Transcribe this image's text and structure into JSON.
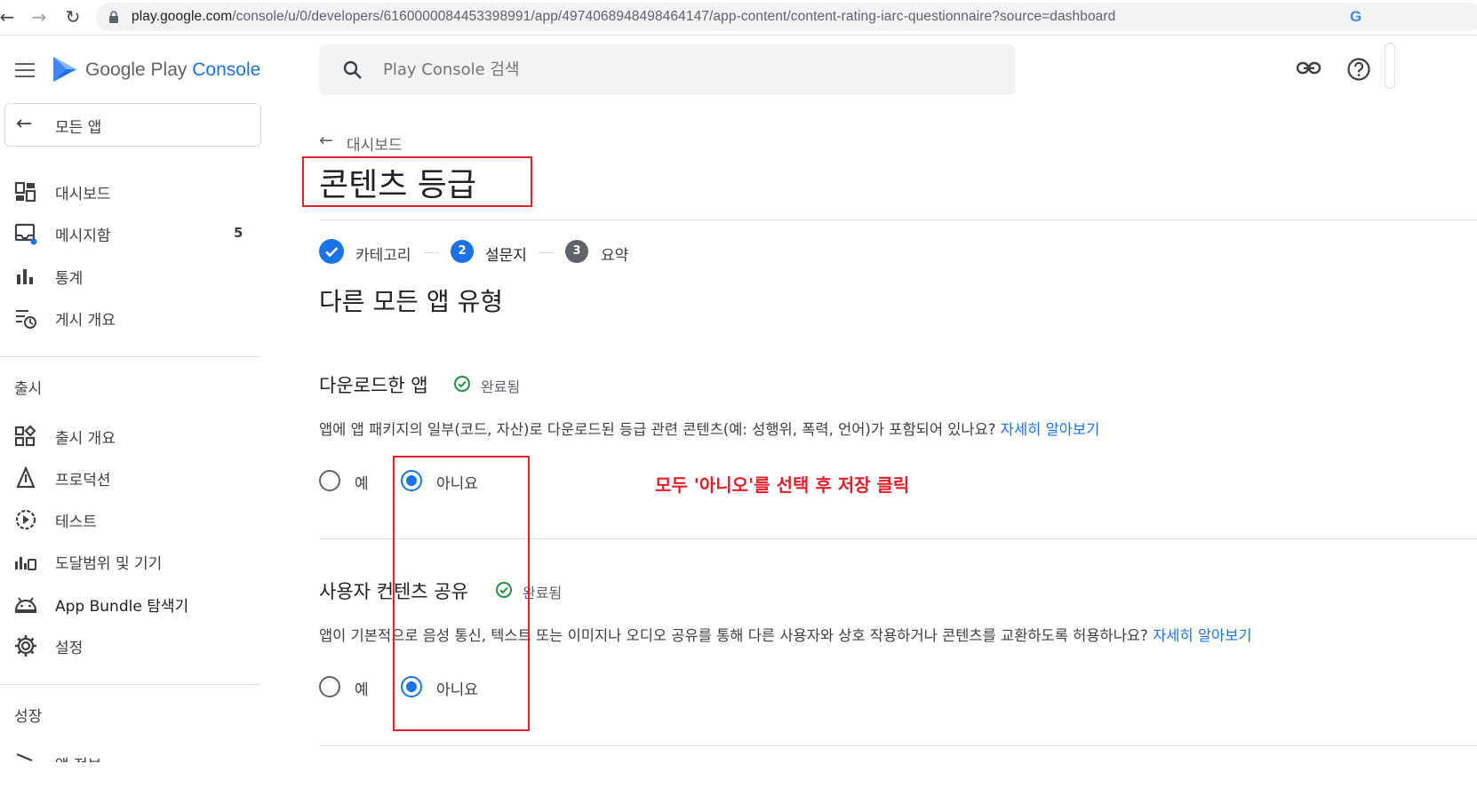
{
  "browser": {
    "url_domain": "play.google.com",
    "url_path": "/console/u/0/developers/6160000084453398991/app/4974068948498464147/app-content/content-rating-iarc-questionnaire?source=dashboard"
  },
  "header": {
    "logo_google_play": "Google Play",
    "logo_console": "Console",
    "search_placeholder": "Play Console 검색"
  },
  "sidebar": {
    "all_apps": "모든 앱",
    "items": [
      {
        "label": "대시보드",
        "icon": "dashboard-icon"
      },
      {
        "label": "메시지함",
        "icon": "inbox-icon",
        "badge": "5"
      },
      {
        "label": "통계",
        "icon": "bar-chart-icon"
      },
      {
        "label": "게시 개요",
        "icon": "publishing-overview-icon"
      }
    ],
    "section_release": "출시",
    "release_items": [
      {
        "label": "출시 개요",
        "icon": "release-overview-icon"
      },
      {
        "label": "프로덕션",
        "icon": "production-icon"
      },
      {
        "label": "테스트",
        "icon": "testing-icon"
      },
      {
        "label": "도달범위 및 기기",
        "icon": "reach-devices-icon"
      },
      {
        "label": "App Bundle 탐색기",
        "icon": "android-icon"
      },
      {
        "label": "설정",
        "icon": "gear-icon"
      }
    ],
    "section_growth": "성장",
    "partial_item": "앱 정보"
  },
  "main": {
    "breadcrumb": "대시보드",
    "page_title": "콘텐츠 등급",
    "steps": [
      {
        "label": "카테고리",
        "state": "done"
      },
      {
        "number": "2",
        "label": "설문지",
        "state": "active"
      },
      {
        "number": "3",
        "label": "요약",
        "state": "pending"
      }
    ],
    "section_title": "다른 모든 앱 유형",
    "questions": [
      {
        "title": "다운로드한 앱",
        "status": "완료됨",
        "text": "앱에 앱 패키지의 일부(코드, 자산)로 다운로드된 등급 관련 콘텐츠(예: 성행위, 폭력, 언어)가 포함되어 있나요?",
        "learn_more": "자세히 알아보기",
        "yes": "예",
        "no": "아니요",
        "selected": "no"
      },
      {
        "title": "사용자 컨텐츠 공유",
        "status": "완료됨",
        "text": "앱이 기본적으로 음성 통신, 텍스트 또는 이미지나 오디오 공유를 통해 다른 사용자와 상호 작용하거나 콘텐츠를 교환하도록 허용하나요?",
        "learn_more": "자세히 알아보기",
        "yes": "예",
        "no": "아니요",
        "selected": "no"
      }
    ],
    "annotation": "모두 '아니오'를 선택 후 저장 클릭"
  },
  "colors": {
    "accent": "#1a73e8",
    "success": "#1e8e3e",
    "annotation_red": "#e0202a"
  }
}
